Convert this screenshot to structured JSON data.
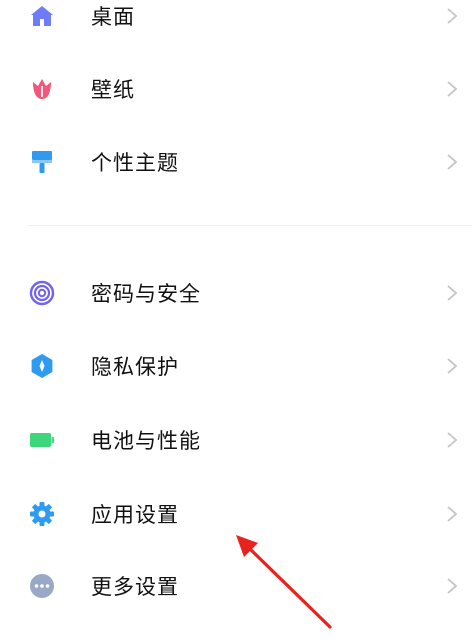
{
  "settings": {
    "group1": [
      {
        "label": "桌面",
        "icon": "home-icon",
        "color": "#6f7cf7"
      },
      {
        "label": "壁纸",
        "icon": "tulip-icon",
        "color": "#f4577a"
      },
      {
        "label": "个性主题",
        "icon": "paint-roller-icon",
        "color": "#2e9bf0"
      }
    ],
    "group2": [
      {
        "label": "密码与安全",
        "icon": "fingerprint-icon",
        "color": "#6f63f0"
      },
      {
        "label": "隐私保护",
        "icon": "privacy-shield-icon",
        "color": "#2e9bf0"
      },
      {
        "label": "电池与性能",
        "icon": "battery-icon",
        "color": "#3ed67a"
      },
      {
        "label": "应用设置",
        "icon": "gear-icon",
        "color": "#2e9bf0"
      },
      {
        "label": "更多设置",
        "icon": "more-dots-icon",
        "color": "#9aa8c8"
      }
    ]
  },
  "annotation": {
    "arrow_color": "#e8221c"
  }
}
